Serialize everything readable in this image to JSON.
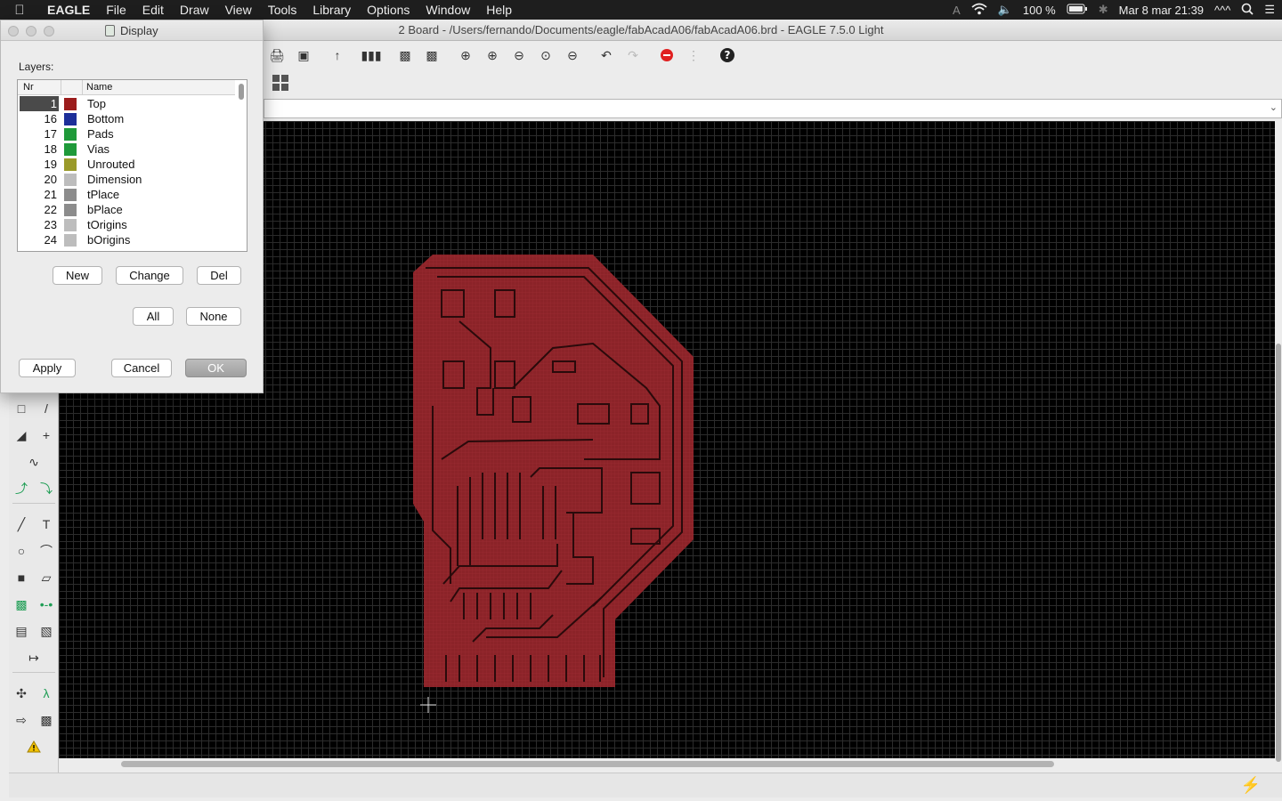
{
  "menubar": {
    "app_name": "EAGLE",
    "items": [
      "File",
      "Edit",
      "Draw",
      "View",
      "Tools",
      "Library",
      "Options",
      "Window",
      "Help"
    ],
    "battery": "100 %",
    "clock": "Mar 8 mar  21:39",
    "ime": "^^^"
  },
  "window": {
    "title": "2 Board - /Users/fernando/Documents/eagle/fabAcadA06/fabAcadA06.brd - EAGLE 7.5.0 Light"
  },
  "dialog": {
    "title": "Display",
    "layers_label": "Layers:",
    "columns": {
      "nr": "Nr",
      "name": "Name"
    },
    "rows": [
      {
        "nr": "1",
        "name": "Top",
        "color": "#9b1c1c",
        "selected": true
      },
      {
        "nr": "16",
        "name": "Bottom",
        "color": "#1d2f99"
      },
      {
        "nr": "17",
        "name": "Pads",
        "color": "#1f9a3a"
      },
      {
        "nr": "18",
        "name": "Vias",
        "color": "#1f9a3a"
      },
      {
        "nr": "19",
        "name": "Unrouted",
        "color": "#9a9a2a"
      },
      {
        "nr": "20",
        "name": "Dimension",
        "color": "#bdbdbd"
      },
      {
        "nr": "21",
        "name": "tPlace",
        "color": "#8c8c8c"
      },
      {
        "nr": "22",
        "name": "bPlace",
        "color": "#8c8c8c"
      },
      {
        "nr": "23",
        "name": "tOrigins",
        "color": "#bdbdbd"
      },
      {
        "nr": "24",
        "name": "bOrigins",
        "color": "#bdbdbd"
      }
    ],
    "buttons": {
      "new": "New",
      "change": "Change",
      "del": "Del",
      "all": "All",
      "none": "None",
      "apply": "Apply",
      "cancel": "Cancel",
      "ok": "OK"
    }
  },
  "colors": {
    "board_copper": "#8b2328",
    "canvas_bg": "#000000",
    "grid": "#2c2c2c",
    "primary_button": "#a8a8a8"
  }
}
